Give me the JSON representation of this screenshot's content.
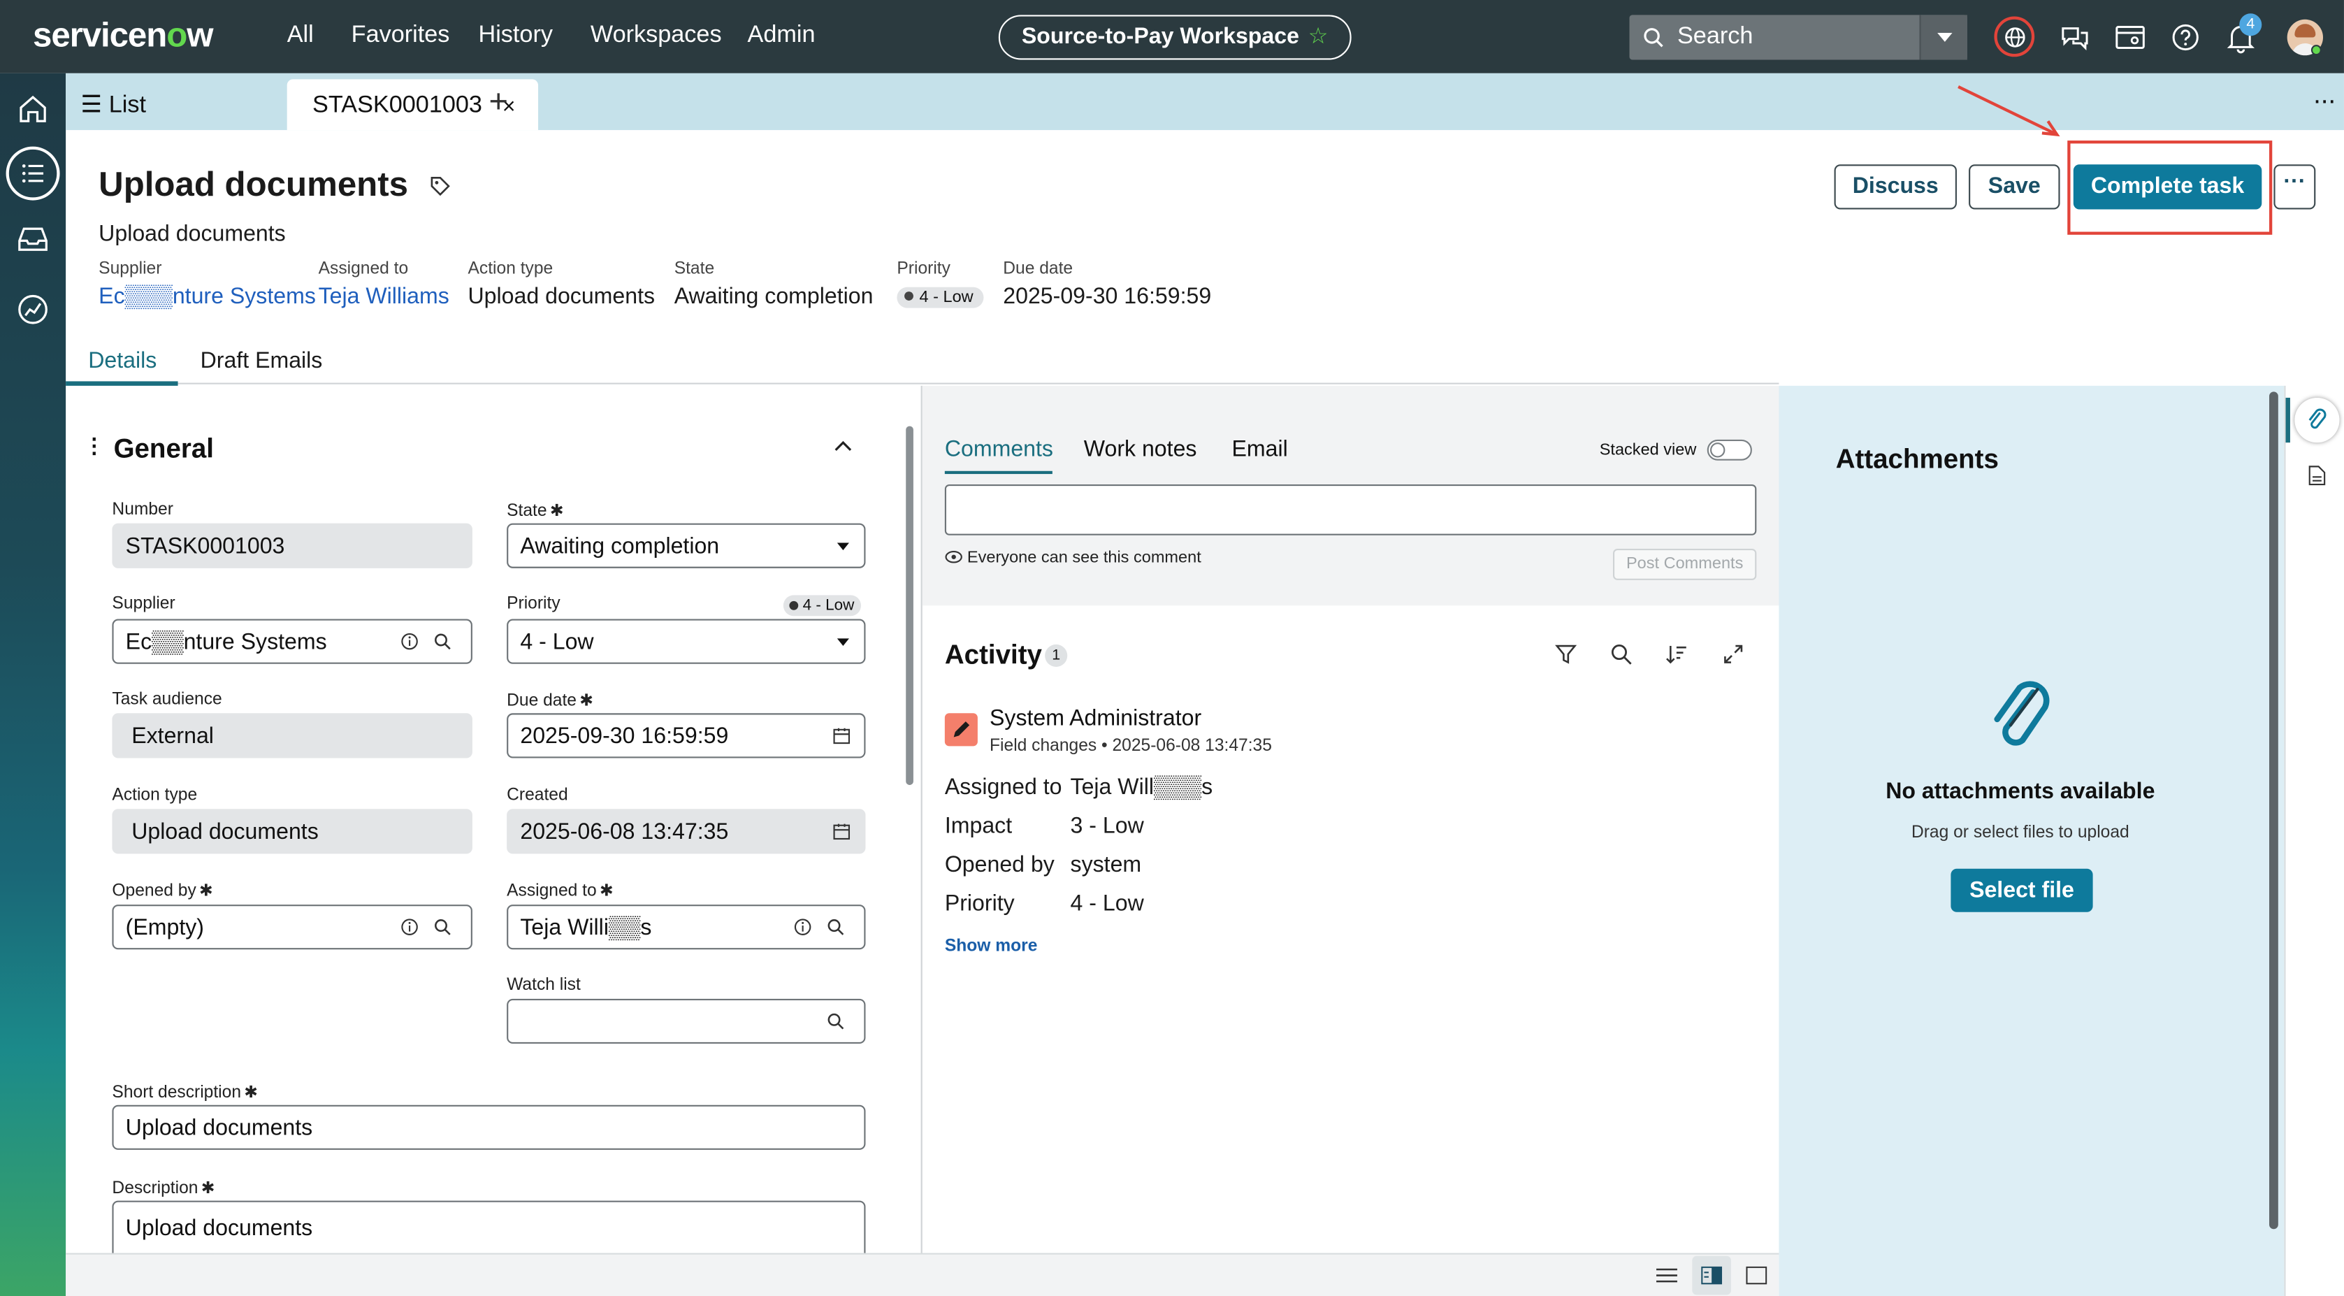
{
  "topnav": {
    "logo_a": "servicen",
    "logo_o": "o",
    "logo_b": "w",
    "links": [
      "All",
      "Favorites",
      "History",
      "Workspaces",
      "Admin"
    ],
    "workspace_pill": "Source-to-Pay Workspace",
    "search_placeholder": "Search",
    "notification_count": "4"
  },
  "tabbar": {
    "list_label": "List",
    "active_tab": "STASK0001003",
    "close": "×",
    "add": "+",
    "more": "···"
  },
  "header": {
    "title": "Upload documents",
    "subtitle": "Upload documents",
    "meta": [
      {
        "label": "Supplier",
        "value": "Ec▒▒▒nture Systems"
      },
      {
        "label": "Assigned to",
        "value": "Teja Williams"
      },
      {
        "label": "Action type",
        "value": "Upload documents"
      },
      {
        "label": "State",
        "value": "Awaiting completion"
      },
      {
        "label": "Priority",
        "value": "4 - Low"
      },
      {
        "label": "Due date",
        "value": "2025-09-30 16:59:59"
      }
    ],
    "buttons": {
      "discuss": "Discuss",
      "save": "Save",
      "complete": "Complete task",
      "more": "···"
    }
  },
  "subtabs": [
    "Details",
    "Draft Emails"
  ],
  "form": {
    "section_title": "General",
    "fields": {
      "number": {
        "label": "Number",
        "value": "STASK0001003"
      },
      "state": {
        "label": "State",
        "value": "Awaiting completion"
      },
      "supplier": {
        "label": "Supplier",
        "value": "Ec▒▒nture Systems"
      },
      "priority": {
        "label": "Priority",
        "value": "4 - Low",
        "badge": "4 - Low"
      },
      "task_audience": {
        "label": "Task audience",
        "value": "External"
      },
      "due_date": {
        "label": "Due date",
        "value": "2025-09-30 16:59:59"
      },
      "action_type": {
        "label": "Action type",
        "value": "Upload documents"
      },
      "created": {
        "label": "Created",
        "value": "2025-06-08 13:47:35"
      },
      "opened_by": {
        "label": "Opened by",
        "value": "(Empty)"
      },
      "assigned_to": {
        "label": "Assigned to",
        "value": "Teja Willi▒▒s"
      },
      "watch_list": {
        "label": "Watch list",
        "value": ""
      },
      "short_description": {
        "label": "Short description",
        "value": "Upload documents"
      },
      "description": {
        "label": "Description",
        "value": "Upload documents"
      }
    },
    "required_mark": "✱"
  },
  "comments": {
    "tabs": [
      "Comments",
      "Work notes",
      "Email"
    ],
    "stacked_view": "Stacked view",
    "visibility": "Everyone can see this comment",
    "post_button": "Post Comments"
  },
  "activity": {
    "title": "Activity",
    "count": "1",
    "entry": {
      "author": "System Administrator",
      "type": "Field changes",
      "timestamp": "2025-06-08 13:47:35",
      "changes": [
        {
          "field": "Assigned to",
          "value": "Teja Will▒▒▒s"
        },
        {
          "field": "Impact",
          "value": "3 - Low"
        },
        {
          "field": "Opened by",
          "value": "system"
        },
        {
          "field": "Priority",
          "value": "4 - Low"
        }
      ]
    },
    "show_more": "Show more"
  },
  "attachments": {
    "title": "Attachments",
    "empty": "No attachments available",
    "hint": "Drag or select files to upload",
    "select_button": "Select file"
  },
  "colors": {
    "nav_bg": "#2b3a3f",
    "accent": "#0e7a9c",
    "highlight": "#e2443a",
    "tabbar": "#c5e1ea"
  }
}
